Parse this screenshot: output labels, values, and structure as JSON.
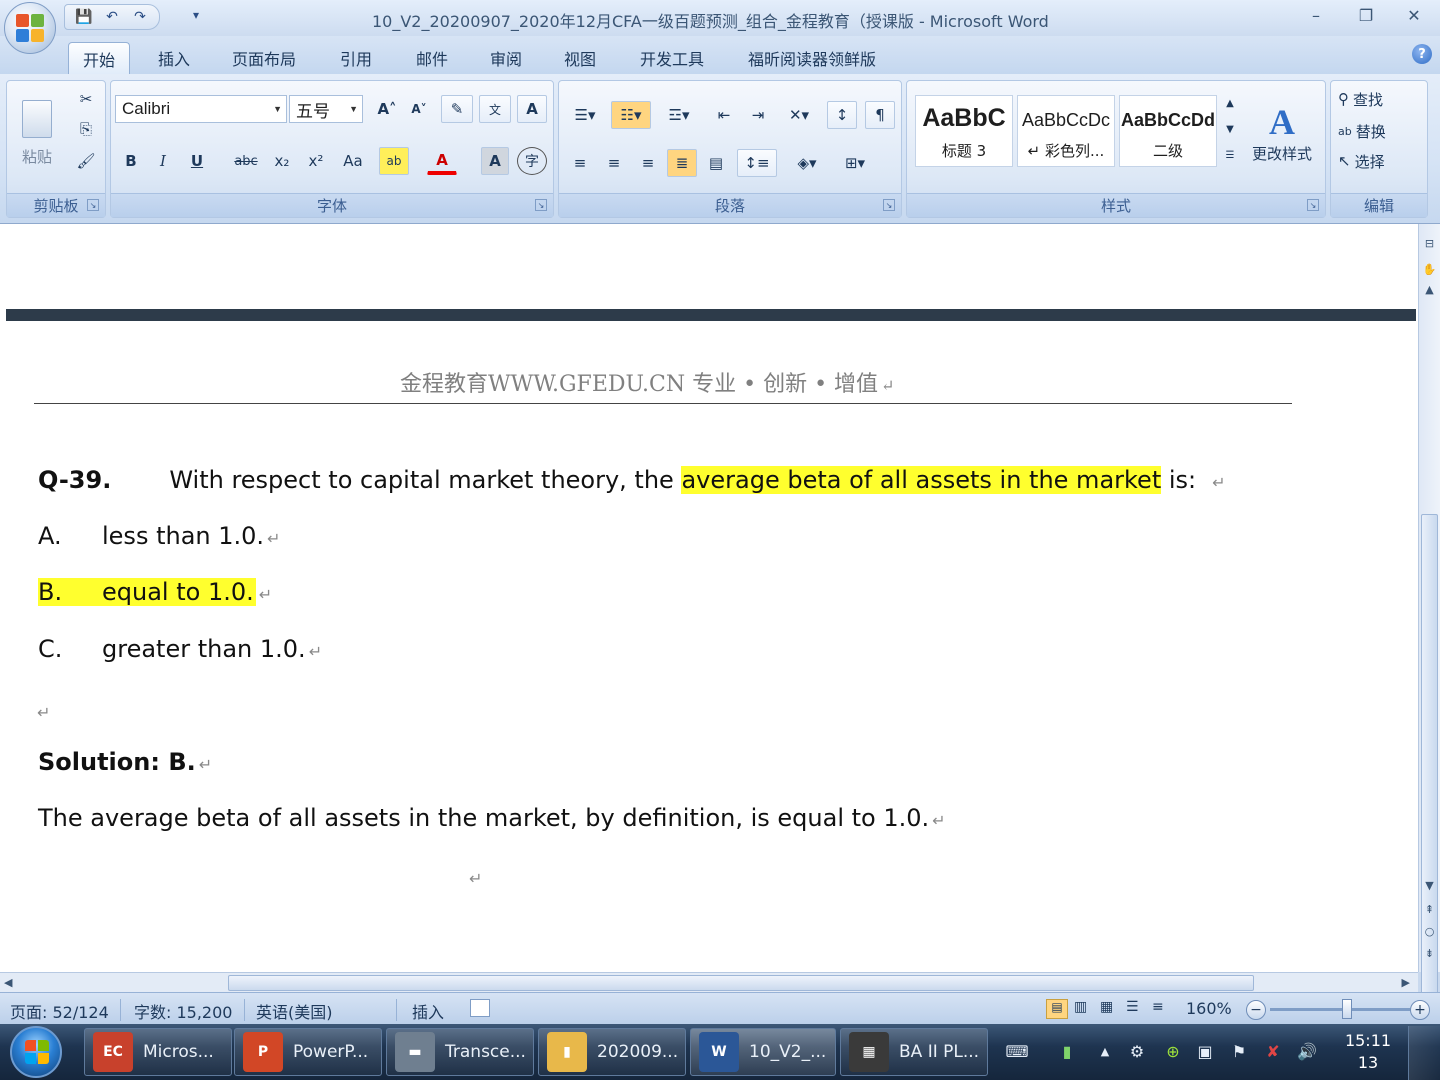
{
  "window": {
    "title": "10_V2_20200907_2020年12月CFA一级百题预测_组合_金程教育（授课版 - Microsoft Word",
    "minimize": "–",
    "maximize": "❐",
    "close": "✕"
  },
  "qat": {
    "save": "💾",
    "undo": "↶",
    "redo": "↷",
    "more": "▾"
  },
  "tabs": [
    "开始",
    "插入",
    "页面布局",
    "引用",
    "邮件",
    "审阅",
    "视图",
    "开发工具",
    "福昕阅读器领鲜版"
  ],
  "help": "?",
  "ribbon": {
    "clipboard": {
      "label": "剪贴板",
      "paste": "粘贴",
      "cut": "✂",
      "copy": "⎘",
      "format_painter": "🖌"
    },
    "font": {
      "label": "字体",
      "font_name": "Calibri",
      "font_size": "五号",
      "grow": "A˄",
      "shrink": "A˅",
      "bold": "B",
      "italic": "I",
      "underline": "U",
      "strike": "abc",
      "subscript": "x₂",
      "superscript": "x²",
      "change_case": "Aa",
      "highlight": "ab",
      "font_color": "A",
      "char_shading": "A",
      "enclose": "字"
    },
    "paragraph": {
      "label": "段落"
    },
    "styles": {
      "label": "样式",
      "items": [
        {
          "sample": "AaBbC",
          "name": "标题 3"
        },
        {
          "sample": "AaBbCcDc",
          "name": "↵ 彩色列..."
        },
        {
          "sample": "AaBbCcDd",
          "name": "二级"
        }
      ],
      "change_styles": "更改样式"
    },
    "editing": {
      "label": "编辑",
      "find": "查找",
      "replace": "替换",
      "select": "选择"
    }
  },
  "document": {
    "header": "金程教育WWW.GFEDU.CN 专业 • 创新 • 增值",
    "question_num": "Q-39.",
    "question_pre": "With respect to capital market theory, the ",
    "question_hl": "average beta of all assets in the market",
    "question_post": " is:",
    "options": [
      {
        "letter": "A.",
        "text": "less than 1.0."
      },
      {
        "letter": "B.",
        "text": "equal to 1.0."
      },
      {
        "letter": "C.",
        "text": "greater than 1.0."
      }
    ],
    "solution": "Solution: B.",
    "explanation": "The average beta of all assets in the market, by definition, is equal to 1.0.",
    "para_mark": "↵"
  },
  "statusbar": {
    "page": "页面: 52/124",
    "words": "字数: 15,200",
    "language": "英语(美国)",
    "mode": "插入",
    "zoom": "160%"
  },
  "taskbar": {
    "items": [
      {
        "label": "Micros...",
        "icon": "EC",
        "color": "#c8412c"
      },
      {
        "label": "PowerP...",
        "icon": "P",
        "color": "#d24726"
      },
      {
        "label": "Transce...",
        "icon": "▬",
        "color": "#6f7f90"
      },
      {
        "label": "202009...",
        "icon": "▮",
        "color": "#e8b84a"
      },
      {
        "label": "10_V2_...",
        "icon": "W",
        "color": "#2b5797"
      },
      {
        "label": "BA II PL...",
        "icon": "▦",
        "color": "#3a3a3a"
      }
    ],
    "clock_time": "15:11",
    "clock_date": "13"
  }
}
